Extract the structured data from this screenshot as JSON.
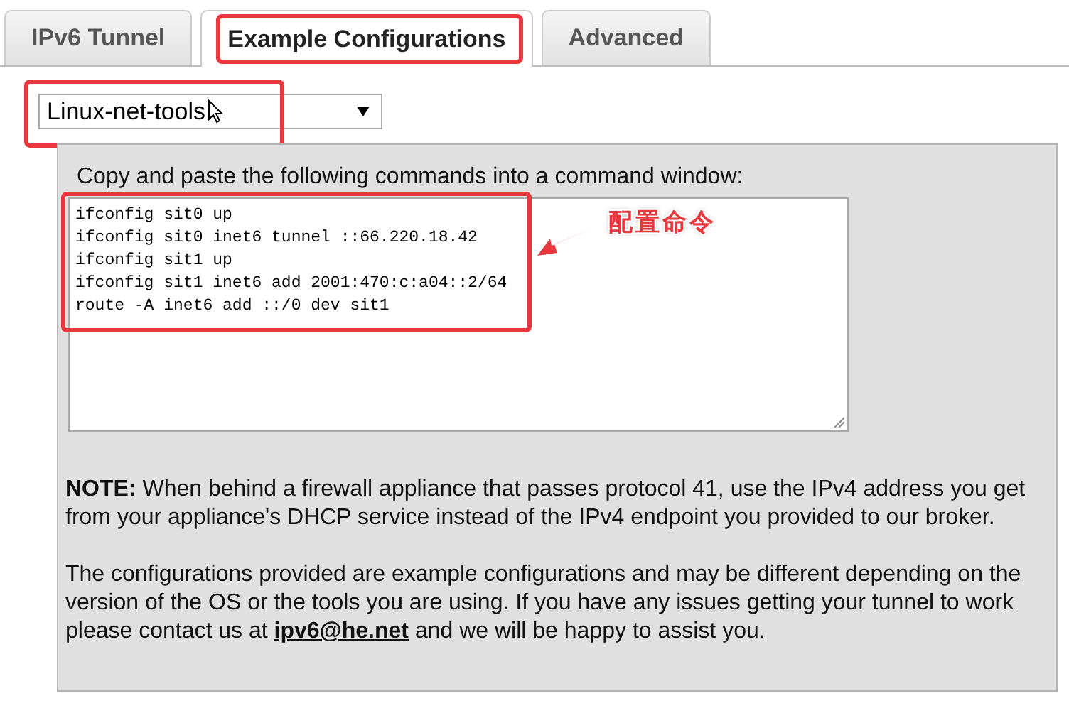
{
  "tabs": [
    {
      "label": "IPv6 Tunnel",
      "selected": false,
      "highlighted": false
    },
    {
      "label": "Example Configurations",
      "selected": true,
      "highlighted": true
    },
    {
      "label": "Advanced",
      "selected": false,
      "highlighted": false
    }
  ],
  "dropdown": {
    "value": "Linux-net-tools",
    "highlighted": true
  },
  "panel": {
    "instruction": "Copy and paste the following commands into a command window:",
    "commands": [
      "ifconfig sit0 up",
      "ifconfig sit0 inet6 tunnel ::66.220.18.42",
      "ifconfig sit1 up",
      "ifconfig sit1 inet6 add 2001:470:c:a04::2/64",
      "route -A inet6 add ::/0 dev sit1"
    ],
    "commands_highlighted": true,
    "note": "**NOTE:** When behind a firewall appliance that passes protocol 41, use the IPv4 address you get from your appliance's DHCP service instead of the IPv4 endpoint you provided to our broker.",
    "disclaimer": {
      "before": "The configurations provided are example configurations and may be different depending on the version of the OS or the tools you are using. If you have any issues getting your tunnel to work please contact us at",
      "link": "ipv6@he.net",
      "after": "and we will be happy to assist you."
    }
  },
  "annotation": {
    "label": "配置命令"
  }
}
